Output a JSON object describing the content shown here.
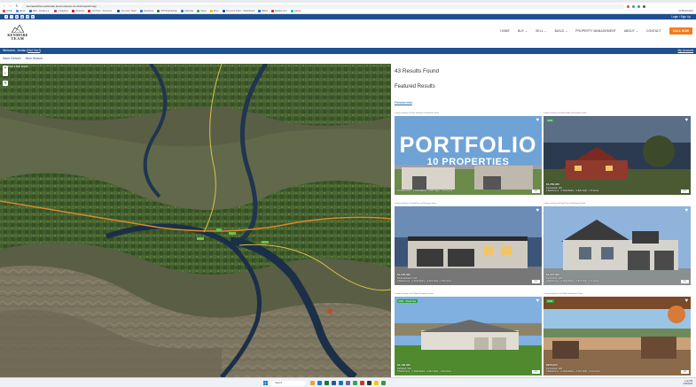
{
  "browser": {
    "url": "kennewickhomesforsale.kenmoreteam.com/idx/search/map",
    "bookmarks": [
      "Gmail",
      "Home",
      "Mail - Jordan Le...",
      "Instagram",
      "Pinterest",
      "YouTube - Kenmore...",
      "Kenmore Team",
      "Facebook",
      "NW Real Estate",
      "Calendar",
      "Maps",
      "Drive",
      "Kenmore Team - Dashboard",
      "Zillow",
      "Realtor.com",
      "Canva"
    ],
    "all_bookmarks": "All Bookmarks"
  },
  "topbar": {
    "social": [
      "f",
      "t",
      "in",
      "ig",
      "yt",
      "@"
    ],
    "login": "Login / Sign Up"
  },
  "site": {
    "logo_line1": "KENMORE",
    "logo_line2": "TEAM",
    "nav": [
      "HOME",
      "BUY",
      "SELL",
      "BUILD",
      "PROPERTY MANAGEMENT",
      "ABOUT",
      "CONTACT"
    ],
    "cta": "CALL NOW"
  },
  "welcome": {
    "text": "Welcome, Jordan (",
    "name_link": "Not You?",
    "close": ")",
    "account": "My Account"
  },
  "search": {
    "save": "Save Search",
    "new": "New Search"
  },
  "map": {
    "zoom_in": "+",
    "zoom_out": "−",
    "layer_label": "Draw a Map Search",
    "draw_icon": "✎"
  },
  "results": {
    "count": "43 Results Found",
    "featured": "Featured Results",
    "type": "Residential",
    "listings": [
      {
        "courtesy": "Listing courtesy of Luke Johnson of Kenmore Team",
        "portfolio_title": "PORTFOLIO",
        "portfolio_sub": "10 PROPERTIES",
        "status": "",
        "info": "10 Bedrooms · 7 Total Baths · 9,987 SqFt · 0.97 Acres"
      },
      {
        "courtesy": "Listing courtesy of Linda Sullins of Kenmore Team",
        "status": "NEW",
        "price": "$1,250,000",
        "address": "Kennewick, WA",
        "info": "4 Bedrooms · 3 Total Baths · 3,840 SqFt · 2.5 Acres"
      },
      {
        "courtesy": "Listing courtesy of David Price of Kenmore Team",
        "status": "",
        "price": "$1,295,000",
        "address": "West Richland, WA",
        "info": "4 Bedrooms · 3 Total Baths · 3,422 SqFt · 0.58 Acres"
      },
      {
        "courtesy": "Listing courtesy of David Price of Kenmore Team",
        "status": "",
        "price": "$1,075,000",
        "address": "Kennewick, WA",
        "info": "4 Bedrooms · 3 Total Baths · 2,876 SqFt · 0.5 Acres"
      },
      {
        "courtesy": "Listing courtesy of Jill Tabb of Kenmore Team",
        "status": "NEW · Virtual Tour",
        "price": "$1,199,900",
        "address": "Richland, WA",
        "info": "5 Bedrooms · 4 Total Baths · 4,010 SqFt · 1.02 Acres"
      },
      {
        "courtesy": "Listing courtesy of Jill Tabb of Kenmore Team",
        "status": "NEW",
        "price": "$950,000",
        "address": "Kennewick, WA",
        "info": "3 Bedrooms · 3 Total Baths · 2,710 SqFt · 0.42 Acres"
      }
    ]
  },
  "taskbar": {
    "search": "Search",
    "time": "1:42 PM",
    "date": "4/18/2024"
  },
  "colors": {
    "brand_blue": "#1e4f8f",
    "cta_orange": "#f47c20",
    "badge_green": "#2e9d3f"
  }
}
